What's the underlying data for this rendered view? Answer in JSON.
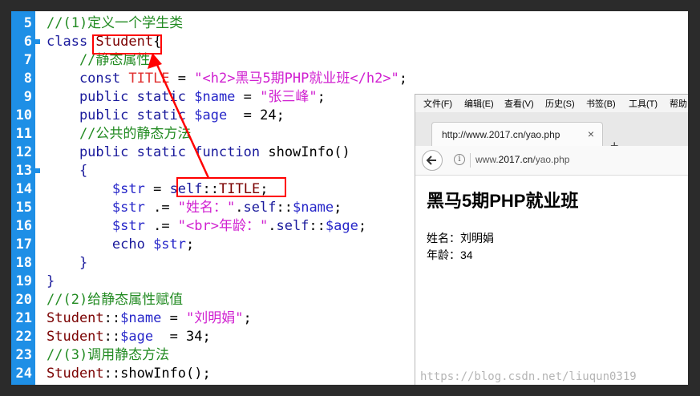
{
  "editor": {
    "lines": [
      {
        "num": "5",
        "tokens": [
          {
            "t": "//(1)定义一个学生类",
            "c": "com"
          }
        ]
      },
      {
        "num": "6",
        "tokens": [
          {
            "t": "class ",
            "c": "kw"
          },
          {
            "t": "Student",
            "c": "cls"
          },
          {
            "t": "{",
            "c": "plain"
          }
        ]
      },
      {
        "num": "7",
        "tokens": [
          {
            "t": "    //静态属性",
            "c": "com"
          }
        ]
      },
      {
        "num": "8",
        "tokens": [
          {
            "t": "    const ",
            "c": "kw"
          },
          {
            "t": "TITLE",
            "c": "const"
          },
          {
            "t": " = ",
            "c": "plain"
          },
          {
            "t": "\"<h2>黑马5期PHP就业班</h2>\"",
            "c": "str"
          },
          {
            "t": ";",
            "c": "plain"
          }
        ]
      },
      {
        "num": "9",
        "tokens": [
          {
            "t": "    public static ",
            "c": "kw"
          },
          {
            "t": "$name",
            "c": "var"
          },
          {
            "t": " = ",
            "c": "plain"
          },
          {
            "t": "\"张三峰\"",
            "c": "str"
          },
          {
            "t": ";",
            "c": "plain"
          }
        ]
      },
      {
        "num": "10",
        "tokens": [
          {
            "t": "    public static ",
            "c": "kw"
          },
          {
            "t": "$age",
            "c": "var"
          },
          {
            "t": "  = 24;",
            "c": "plain"
          }
        ]
      },
      {
        "num": "11",
        "tokens": [
          {
            "t": "    //公共的静态方法",
            "c": "com"
          }
        ]
      },
      {
        "num": "12",
        "tokens": [
          {
            "t": "    public static function ",
            "c": "kw"
          },
          {
            "t": "showInfo()",
            "c": "plain"
          }
        ]
      },
      {
        "num": "13",
        "tokens": [
          {
            "t": "    {",
            "c": "kw"
          }
        ]
      },
      {
        "num": "14",
        "tokens": [
          {
            "t": "        ",
            "c": "plain"
          },
          {
            "t": "$str",
            "c": "var"
          },
          {
            "t": " = ",
            "c": "plain"
          },
          {
            "t": "self",
            "c": "kw"
          },
          {
            "t": "::",
            "c": "plain"
          },
          {
            "t": "TITLE",
            "c": "cls"
          },
          {
            "t": ";",
            "c": "plain"
          }
        ]
      },
      {
        "num": "15",
        "tokens": [
          {
            "t": "        ",
            "c": "plain"
          },
          {
            "t": "$str",
            "c": "var"
          },
          {
            "t": " .= ",
            "c": "plain"
          },
          {
            "t": "\"姓名：\"",
            "c": "str"
          },
          {
            "t": ".",
            "c": "plain"
          },
          {
            "t": "self",
            "c": "kw"
          },
          {
            "t": "::",
            "c": "plain"
          },
          {
            "t": "$name",
            "c": "var"
          },
          {
            "t": ";",
            "c": "plain"
          }
        ]
      },
      {
        "num": "16",
        "tokens": [
          {
            "t": "        ",
            "c": "plain"
          },
          {
            "t": "$str",
            "c": "var"
          },
          {
            "t": " .= ",
            "c": "plain"
          },
          {
            "t": "\"<br>年龄：\"",
            "c": "str"
          },
          {
            "t": ".",
            "c": "plain"
          },
          {
            "t": "self",
            "c": "kw"
          },
          {
            "t": "::",
            "c": "plain"
          },
          {
            "t": "$age",
            "c": "var"
          },
          {
            "t": ";",
            "c": "plain"
          }
        ]
      },
      {
        "num": "17",
        "tokens": [
          {
            "t": "        echo ",
            "c": "kw"
          },
          {
            "t": "$str",
            "c": "var"
          },
          {
            "t": ";",
            "c": "plain"
          }
        ]
      },
      {
        "num": "18",
        "tokens": [
          {
            "t": "    }",
            "c": "kw"
          }
        ]
      },
      {
        "num": "19",
        "tokens": [
          {
            "t": "}",
            "c": "kw"
          }
        ]
      },
      {
        "num": "20",
        "tokens": [
          {
            "t": "//(2)给静态属性赋值",
            "c": "com"
          }
        ]
      },
      {
        "num": "21",
        "tokens": [
          {
            "t": "Student",
            "c": "cls"
          },
          {
            "t": "::",
            "c": "plain"
          },
          {
            "t": "$name",
            "c": "var"
          },
          {
            "t": " = ",
            "c": "plain"
          },
          {
            "t": "\"刘明娟\"",
            "c": "str"
          },
          {
            "t": ";",
            "c": "plain"
          }
        ]
      },
      {
        "num": "22",
        "tokens": [
          {
            "t": "Student",
            "c": "cls"
          },
          {
            "t": "::",
            "c": "plain"
          },
          {
            "t": "$age",
            "c": "var"
          },
          {
            "t": "  = 34;",
            "c": "plain"
          }
        ]
      },
      {
        "num": "23",
        "tokens": [
          {
            "t": "//(3)调用静态方法",
            "c": "com"
          }
        ]
      },
      {
        "num": "24",
        "tokens": [
          {
            "t": "Student",
            "c": "cls"
          },
          {
            "t": "::",
            "c": "plain"
          },
          {
            "t": "showInfo();",
            "c": "plain"
          }
        ]
      }
    ]
  },
  "browser": {
    "menu": [
      "文件(F)",
      "编辑(E)",
      "查看(V)",
      "历史(S)",
      "书签(B)",
      "工具(T)",
      "帮助"
    ],
    "tab_title": "http://www.2017.cn/yao.php",
    "tab_close": "×",
    "new_tab": "+",
    "url_prefix": "www.",
    "url_domain": "2017.cn",
    "url_path": "/yao.php",
    "info_icon": "i",
    "back_icon": "back-arrow-icon",
    "page": {
      "heading": "黑马5期PHP就业班",
      "name_line": "姓名：刘明娟",
      "age_line": "年龄：34"
    }
  },
  "watermark": "https://blog.csdn.net/liuqun0319",
  "colors": {
    "gutter": "#1e8fe6",
    "highlight": "#ff0000",
    "comment": "#228b22",
    "keyword": "#1a1a9c",
    "string": "#d020d0",
    "constant": "#e03030"
  }
}
